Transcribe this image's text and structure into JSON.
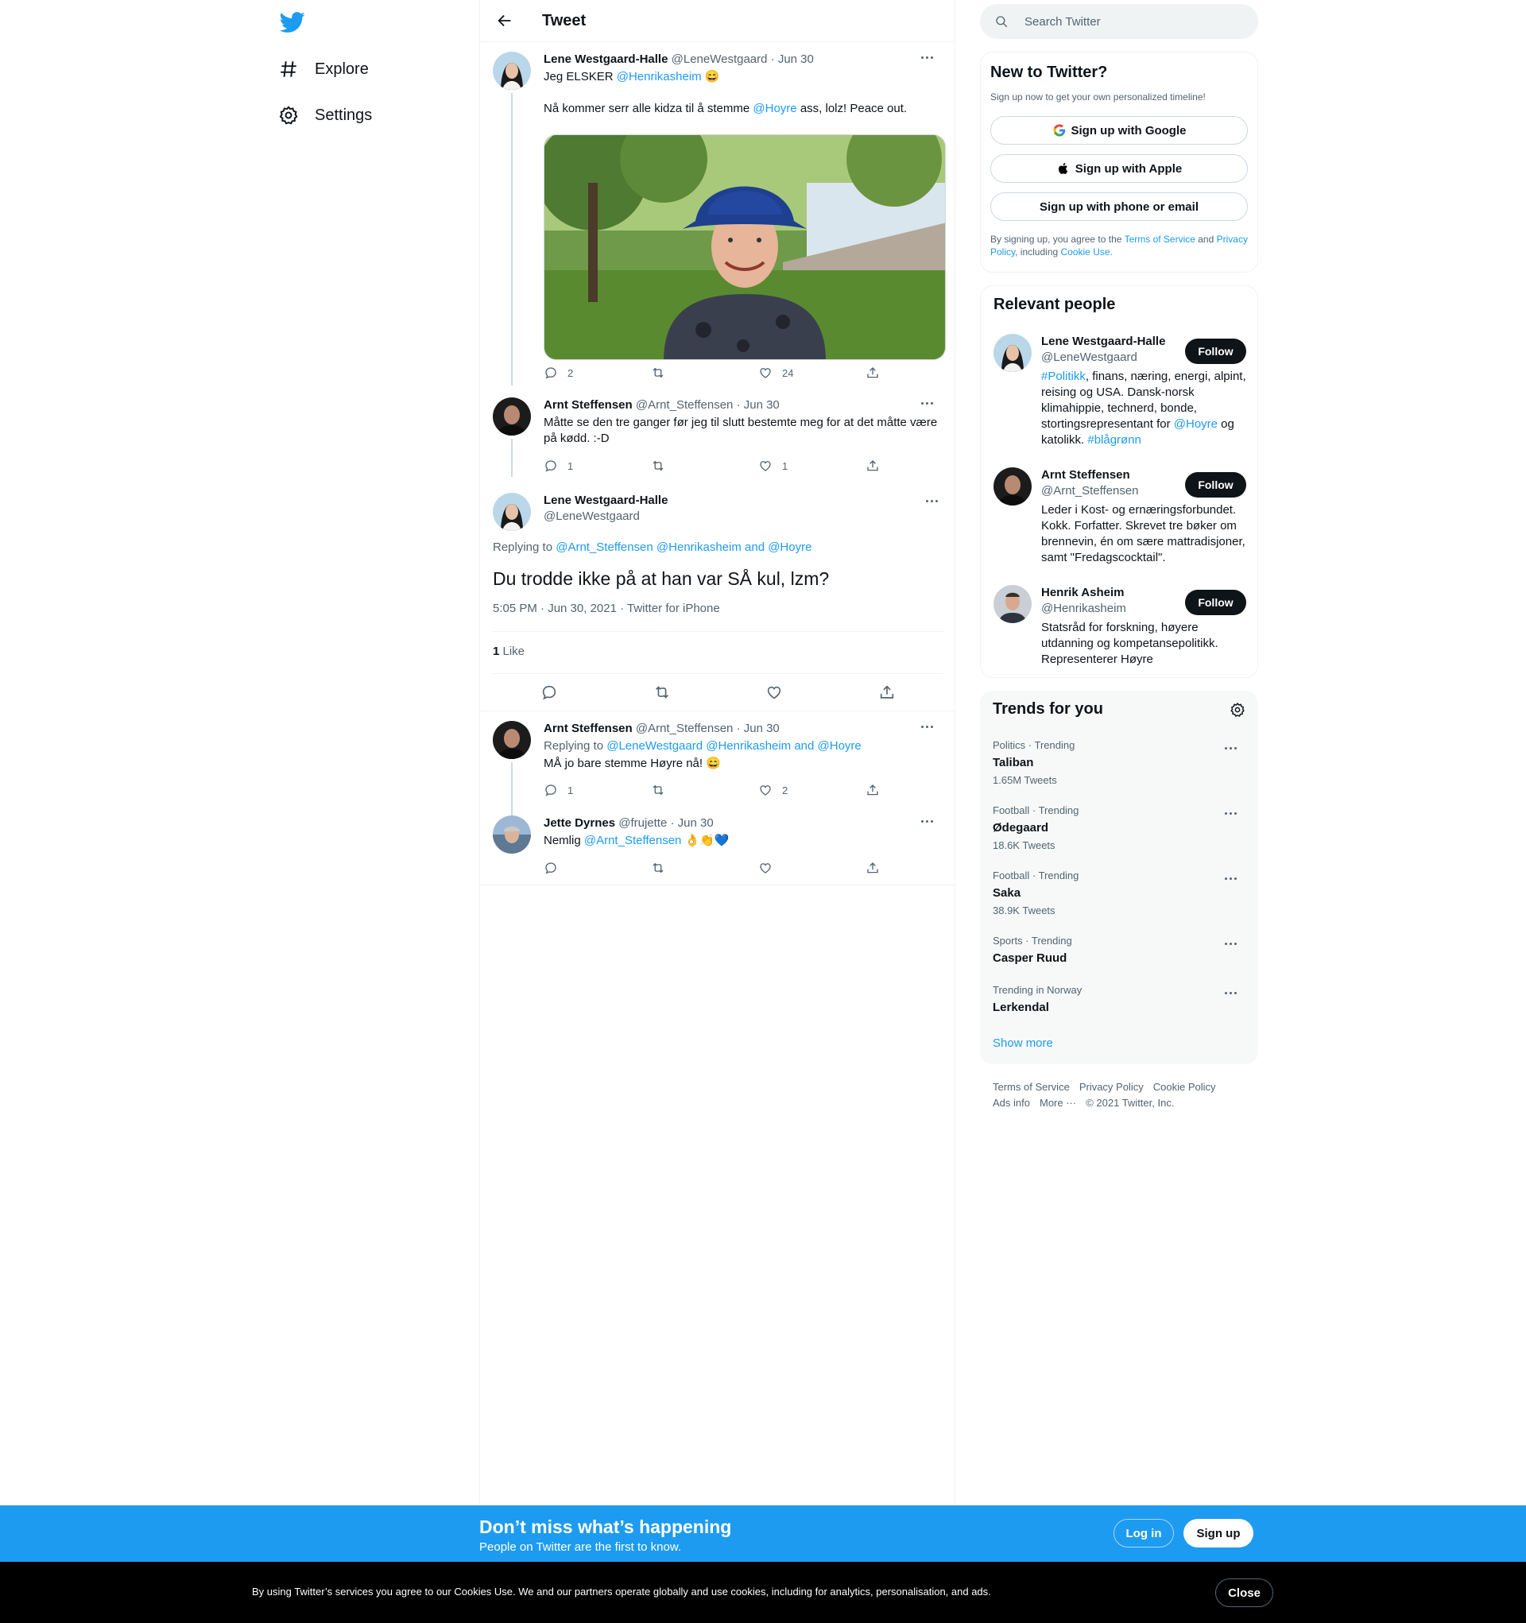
{
  "nav": {
    "explore": "Explore",
    "settings": "Settings"
  },
  "header": {
    "title": "Tweet"
  },
  "thread": [
    {
      "name": "Lene Westgaard-Halle",
      "handle": "@LeneWestgaard",
      "date": "· Jun 30",
      "line1_pre": "Jeg ELSKER ",
      "line1_mention": "@Henrikasheim",
      "line1_emoji": "😄",
      "line2_pre": "Nå kommer serr alle kidza til å stemme ",
      "line2_mention": "@Hoyre",
      "line2_post": " ass, lolz! Peace out.",
      "replies": "2",
      "retweets": "",
      "likes": "24"
    },
    {
      "name": "Arnt Steffensen",
      "handle": "@Arnt_Steffensen",
      "date": "· Jun 30",
      "text": "Måtte se den tre ganger før jeg til slutt bestemte meg for at det måtte være på kødd. :-D",
      "replies": "1",
      "retweets": "",
      "likes": "1"
    }
  ],
  "focus": {
    "name": "Lene Westgaard-Halle",
    "handle": "@LeneWestgaard",
    "replying_label": "Replying to ",
    "replying_mentions": "@Arnt_Steffensen @Henrikasheim and @Hoyre",
    "text": "Du trodde ikke på at han var SÅ kul, lzm?",
    "time": "5:05 PM · Jun 30, 2021 · Twitter for iPhone",
    "like_count": "1",
    "like_label": " Like"
  },
  "replies": [
    {
      "name": "Arnt Steffensen",
      "handle": "@Arnt_Steffensen",
      "date": "· Jun 30",
      "replying_label": "Replying to ",
      "replying_mentions": "@LeneWestgaard @Henrikasheim and @Hoyre",
      "text": "MÅ jo bare stemme Høyre nå! 😄",
      "replies": "1",
      "retweets": "",
      "likes": "2"
    },
    {
      "name": "Jette Dyrnes",
      "handle": "@frujette",
      "date": "· Jun 30",
      "text_pre": "Nemlig ",
      "text_mention": "@Arnt_Steffensen",
      "text_emoji": " 👌👏💙",
      "replies": "",
      "retweets": "",
      "likes": ""
    }
  ],
  "search": {
    "placeholder": "Search Twitter"
  },
  "new_to_twitter": {
    "title": "New to Twitter?",
    "subtitle": "Sign up now to get your own personalized timeline!",
    "google": "Sign up with Google",
    "apple": "Sign up with Apple",
    "phone": "Sign up with phone or email",
    "legal_pre": "By signing up, you agree to the ",
    "terms": "Terms of Service",
    "and": " and ",
    "privacy": "Privacy Policy",
    "including": ", including ",
    "cookie": "Cookie Use."
  },
  "relevant": {
    "title": "Relevant people",
    "follow": "Follow",
    "people": [
      {
        "name": "Lene Westgaard-Halle",
        "handle": "@LeneWestgaard",
        "bio_tag": "#Politikk",
        "bio_a": ", finans, næring, energi, alpint, reising og USA. Dansk-norsk klimahippie, technerd, bonde, stortingsrepresentant for ",
        "bio_mention": "@Hoyre",
        "bio_b": " og katolikk. ",
        "bio_tag2": "#blågrønn"
      },
      {
        "name": "Arnt Steffensen",
        "handle": "@Arnt_Steffensen",
        "bio": "Leder i Kost- og ernæringsforbundet. Kokk. Forfatter. Skrevet tre bøker om brennevin, én om sære mattradisjoner, samt \"Fredagscocktail\"."
      },
      {
        "name": "Henrik Asheim",
        "handle": "@Henrikasheim",
        "bio": "Statsråd for forskning, høyere utdanning og kompetansepolitikk. Representerer Høyre"
      }
    ]
  },
  "trends": {
    "title": "Trends for you",
    "items": [
      {
        "context": "Politics · Trending",
        "name": "Taliban",
        "count": "1.65M Tweets"
      },
      {
        "context": "Football · Trending",
        "name": "Ødegaard",
        "count": "18.6K Tweets"
      },
      {
        "context": "Football · Trending",
        "name": "Saka",
        "count": "38.9K Tweets"
      },
      {
        "context": "Sports · Trending",
        "name": "Casper Ruud",
        "count": ""
      },
      {
        "context": "Trending in Norway",
        "name": "Lerkendal",
        "count": ""
      }
    ],
    "show_more": "Show more"
  },
  "footer": {
    "terms": "Terms of Service",
    "privacy": "Privacy Policy",
    "cookie": "Cookie Policy",
    "ads": "Ads info",
    "more": "More ···",
    "copyright": "© 2021 Twitter, Inc."
  },
  "banner": {
    "title": "Don’t miss what’s happening",
    "subtitle": "People on Twitter are the first to know.",
    "login": "Log in",
    "signup": "Sign up"
  },
  "cookie_bar": {
    "text": "By using Twitter’s services you agree to our Cookies Use. We and our partners operate globally and use cookies, including for analytics, personalisation, and ads.",
    "close": "Close"
  },
  "colors": {
    "accent": "#1d9bf0",
    "text": "#0f1419",
    "muted": "#536471"
  }
}
